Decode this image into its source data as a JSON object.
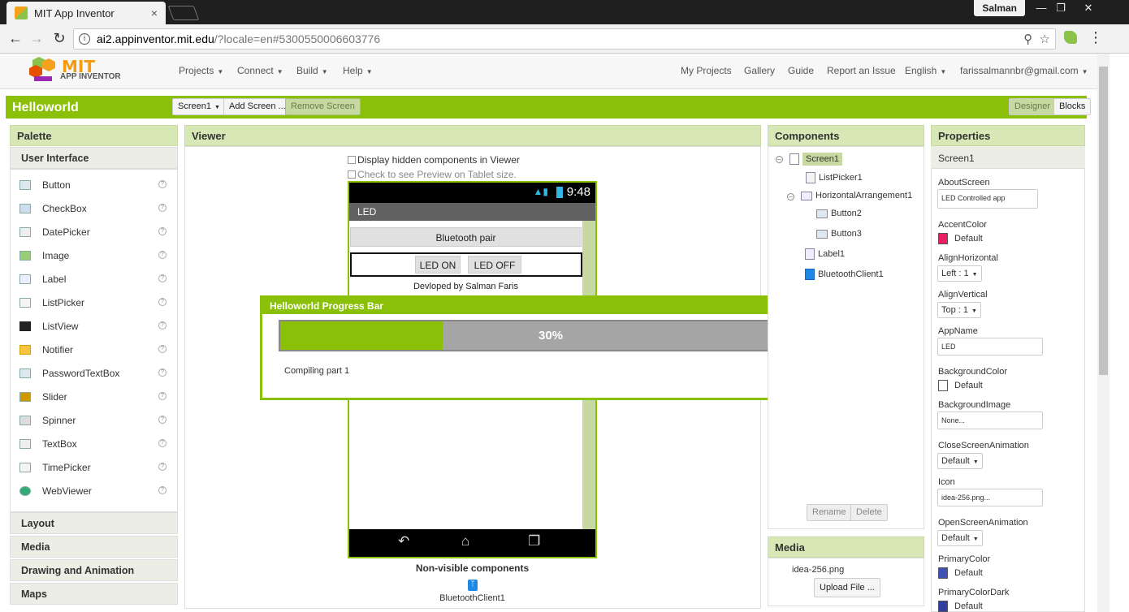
{
  "browser": {
    "tab_title": "MIT App Inventor",
    "tab_close": "×",
    "profile_name": "Salman",
    "url_host": "ai2.appinventor.mit.edu",
    "url_rest": "/?locale=en#5300550006603776"
  },
  "app": {
    "logo_mit": "MIT",
    "logo_sub": "APP INVENTOR",
    "menu_left": [
      "Projects",
      "Connect",
      "Build",
      "Help"
    ],
    "menu_right": [
      "My Projects",
      "Gallery",
      "Guide",
      "Report an Issue",
      "English",
      "farissalmannbr@gmail.com"
    ]
  },
  "project": {
    "name": "Helloworld",
    "screen_select": "Screen1",
    "add_screen": "Add Screen ...",
    "remove_screen": "Remove Screen",
    "designer": "Designer",
    "blocks": "Blocks"
  },
  "palette": {
    "title": "Palette",
    "category_open": "User Interface",
    "items": [
      "Button",
      "CheckBox",
      "DatePicker",
      "Image",
      "Label",
      "ListPicker",
      "ListView",
      "Notifier",
      "PasswordTextBox",
      "Slider",
      "Spinner",
      "TextBox",
      "TimePicker",
      "WebViewer"
    ],
    "categories_closed": [
      "Layout",
      "Media",
      "Drawing and Animation",
      "Maps"
    ]
  },
  "viewer": {
    "title": "Viewer",
    "chk_hidden": "Display hidden components in Viewer",
    "chk_tablet": "Check to see Preview on Tablet size.",
    "phone_time": "9:48",
    "phone_title": "LED",
    "btn_pair": "Bluetooth pair",
    "btn_on": "LED ON",
    "btn_off": "LED OFF",
    "label_text": "Devloped by Salman Faris",
    "nonvisible_title": "Non-visible components",
    "nonvisible_item": "BluetoothClient1"
  },
  "progress": {
    "title": "Helloworld Progress Bar",
    "percent_text": "30%",
    "percent": 30,
    "message": "Compiling part 1"
  },
  "components": {
    "title": "Components",
    "tree": [
      "Screen1",
      "ListPicker1",
      "HorizontalArrangement1",
      "Button2",
      "Button3",
      "Label1",
      "BluetoothClient1"
    ],
    "rename": "Rename",
    "delete": "Delete"
  },
  "media": {
    "title": "Media",
    "file": "idea-256.png",
    "upload": "Upload File ..."
  },
  "properties": {
    "title": "Properties",
    "component": "Screen1",
    "about_label": "AboutScreen",
    "about_value": "LED Controlled app",
    "accent_label": "AccentColor",
    "accent_value": "Default",
    "accent_color": "#e91e63",
    "alignh_label": "AlignHorizontal",
    "alignh_value": "Left : 1",
    "alignv_label": "AlignVertical",
    "alignv_value": "Top : 1",
    "appname_label": "AppName",
    "appname_value": "LED",
    "bgcolor_label": "BackgroundColor",
    "bgcolor_value": "Default",
    "bgimage_label": "BackgroundImage",
    "bgimage_value": "None...",
    "closeanim_label": "CloseScreenAnimation",
    "closeanim_value": "Default",
    "icon_label": "Icon",
    "icon_value": "idea-256.png...",
    "openanim_label": "OpenScreenAnimation",
    "openanim_value": "Default",
    "primary_label": "PrimaryColor",
    "primary_value": "Default",
    "primary_color": "#3f51b5",
    "primarydark_label": "PrimaryColorDark",
    "primarydark_value": "Default",
    "primarydark_color": "#303f9f"
  }
}
